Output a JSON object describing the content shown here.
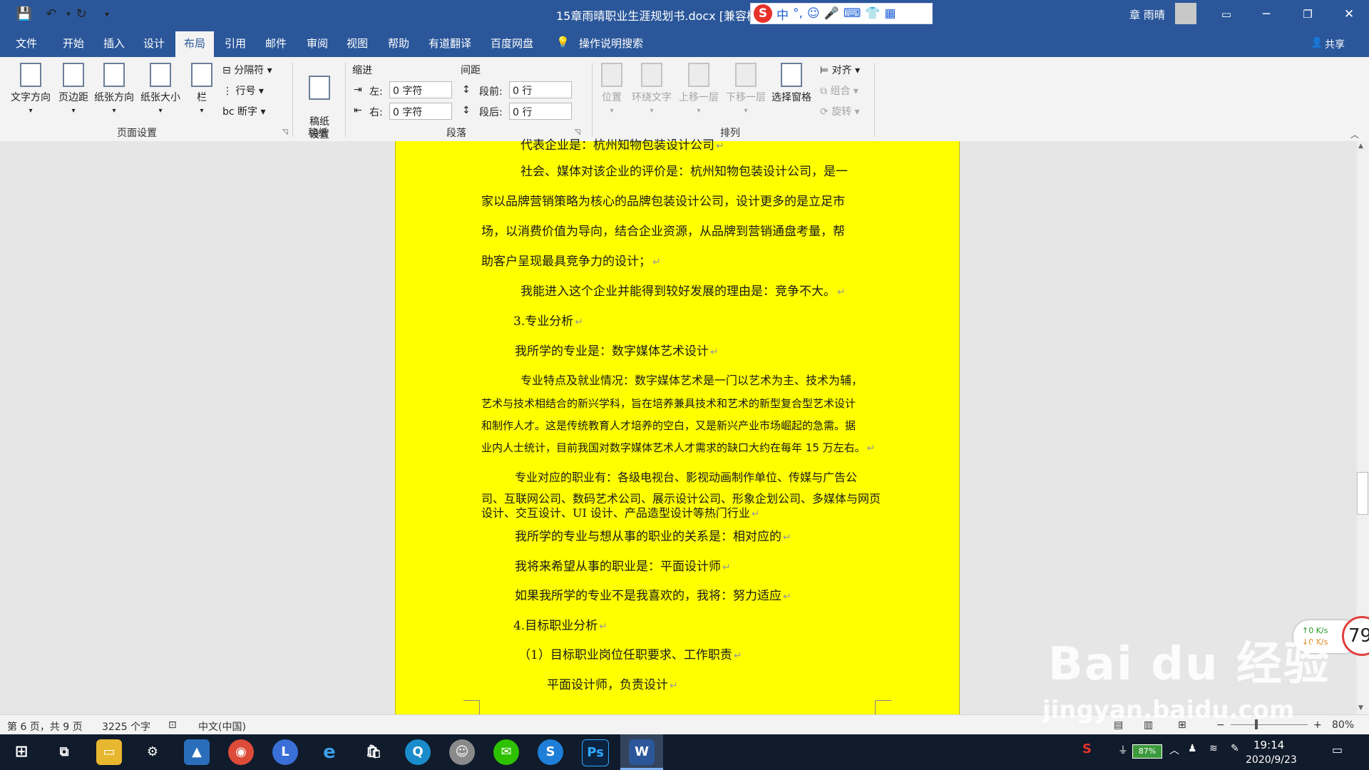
{
  "titlebar": {
    "doc_title": "15章雨晴职业生涯规划书.docx [兼容模",
    "ime_items": [
      "中",
      "°,",
      "☺",
      "🎤",
      "⌨",
      "👕",
      "▦"
    ],
    "user_name": "章 雨晴",
    "bg_color": "#2b579a"
  },
  "tabs": [
    "文件",
    "开始",
    "插入",
    "设计",
    "布局",
    "引用",
    "邮件",
    "审阅",
    "视图",
    "帮助",
    "有道翻译",
    "百度网盘"
  ],
  "active_tab": "布局",
  "tell_me": "操作说明搜索",
  "share": "共享",
  "ribbon": {
    "page_setup": {
      "label": "页面设置",
      "buttons": [
        "文字方向",
        "页边距",
        "纸张方向",
        "纸张大小",
        "栏"
      ],
      "small": [
        "分隔符",
        "行号",
        "断字"
      ]
    },
    "manuscript": {
      "label": "稿纸",
      "button": "稿纸\n设置"
    },
    "paragraph": {
      "label": "段落",
      "indent_title": "缩进",
      "spacing_title": "间距",
      "left_label": "左:",
      "right_label": "右:",
      "before_label": "段前:",
      "after_label": "段后:",
      "left_value": "0 字符",
      "right_value": "0 字符",
      "before_value": "0 行",
      "after_value": "0 行"
    },
    "arrange": {
      "label": "排列",
      "buttons": [
        "位置",
        "环绕文字",
        "上移一层",
        "下移一层",
        "选择窗格"
      ],
      "small": [
        "对齐",
        "组合",
        "旋转"
      ]
    }
  },
  "document": {
    "p0": "代表企业是：杭州知物包装设计公司",
    "p1": "社会、媒体对该企业的评价是：杭州知物包装设计公司，是一",
    "p2": "家以品牌营销策略为核心的品牌包装设计公司，设计更多的是立足市",
    "p3": "场，以消费价值为导向，结合企业资源，从品牌到营销通盘考量，帮",
    "p4": "助客户呈现最具竞争力的设计；",
    "p5": "我能进入这个企业并能得到较好发展的理由是：竞争不大。",
    "p6": "3.专业分析",
    "p7": "我所学的专业是：数字媒体艺术设计",
    "p8": "专业特点及就业情况：数字媒体艺术是一门以艺术为主、技术为辅，",
    "p9": "艺术与技术相结合的新兴学科，旨在培养兼具技术和艺术的新型复合型艺术设计",
    "p10": "和制作人才。这是传统教育人才培养的空白，又是新兴产业市场崛起的急需。据",
    "p11": "业内人士统计，目前我国对数字媒体艺术人才需求的缺口大约在每年 15 万左右。",
    "p12": "专业对应的职业有：各级电视台、影视动画制作单位、传媒与广告公",
    "p13": "司、互联网公司、数码艺术公司、展示设计公司、形象企划公司、多媒体与网页",
    "p14": "设计、交互设计、UI 设计、产品造型设计等热门行业",
    "p15": "我所学的专业与想从事的职业的关系是：相对应的",
    "p16": "我将来希望从事的职业是：平面设计师",
    "p17": "如果我所学的专业不是我喜欢的，我将：努力适应",
    "p18": "4.目标职业分析",
    "p19": "（1）目标职业岗位任职要求、工作职责",
    "p20": "平面设计师，负责设计",
    "para_mark": "↵",
    "page_color": "#ffff00"
  },
  "status": {
    "page": "第 6 页，共 9 页",
    "words": "3225 个字",
    "language": "中文(中国)",
    "zoom": "80%"
  },
  "taskbar": {
    "time": "19:14",
    "date": "2020/9/23",
    "battery": "87%"
  },
  "widgets": {
    "up_speed": "↑0  K/s",
    "down_speed": "↓0  K/s",
    "ball": "79",
    "watermark_main": "Bai du 经验",
    "watermark_sub": "jingyan.baidu.com"
  }
}
